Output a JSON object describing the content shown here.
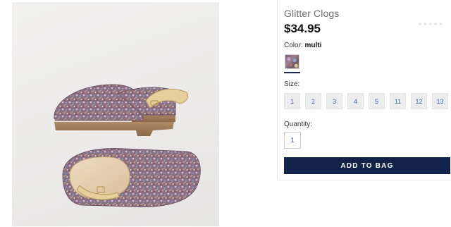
{
  "product": {
    "title": "Glitter Clogs",
    "price": "$34.95",
    "rating_stars": [
      "★",
      "★",
      "★",
      "★",
      "★"
    ],
    "image_alt": "glitter-clogs-product-photo"
  },
  "color": {
    "label": "Color:",
    "selected": "multi",
    "swatch_name": "multi"
  },
  "size": {
    "label": "Size:",
    "options": [
      "1",
      "2",
      "3",
      "4",
      "5",
      "11",
      "12",
      "13"
    ]
  },
  "quantity": {
    "label": "Quantity:",
    "value": "1"
  },
  "cart": {
    "add_label": "ADD TO BAG"
  },
  "colors": {
    "accent": "#122249",
    "size_text": "#3b5fa8",
    "size_bg": "#ededed",
    "title_text": "#6c6c6c"
  }
}
